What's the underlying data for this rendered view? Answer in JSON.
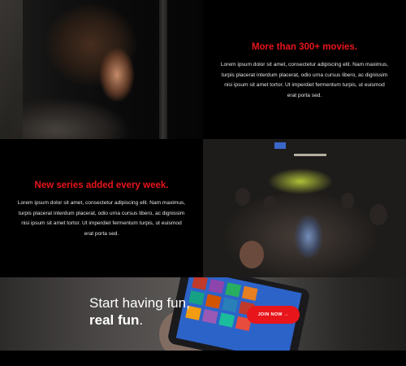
{
  "section_movies": {
    "heading": "More than 300+ movies.",
    "paragraph": "Lorem ipsum dolor sit amet, consectetur adipiscing elit. Nam maximus, turpis placerat interdum placerat, odio urna cursus libero, ac dignissim nisi ipsum sit amet tortor. Ut imperdiet fermentum turpis, ut euismod erat porta sed."
  },
  "section_series": {
    "heading": "New series added every week.",
    "paragraph": "Lorem ipsum dolor sit amet, consectetur adipiscing elit. Nam maximus, turpis placerat interdum placerat, odio urna cursus libero, ac dignissim nisi ipsum sit amet tortor. Ut imperdiet fermentum turpis, ut euismod erat porta sed."
  },
  "cta": {
    "line1": "Start having fun,",
    "line2_bold": "real fun",
    "line2_end": ".",
    "button_label": "JOIN NOW →"
  },
  "colors": {
    "accent": "#e8151b",
    "background": "#000000"
  },
  "images": {
    "photo1": "man-watching-photo",
    "photo2": "crowd-street-photo",
    "banner": "phone-in-hand-photo"
  }
}
